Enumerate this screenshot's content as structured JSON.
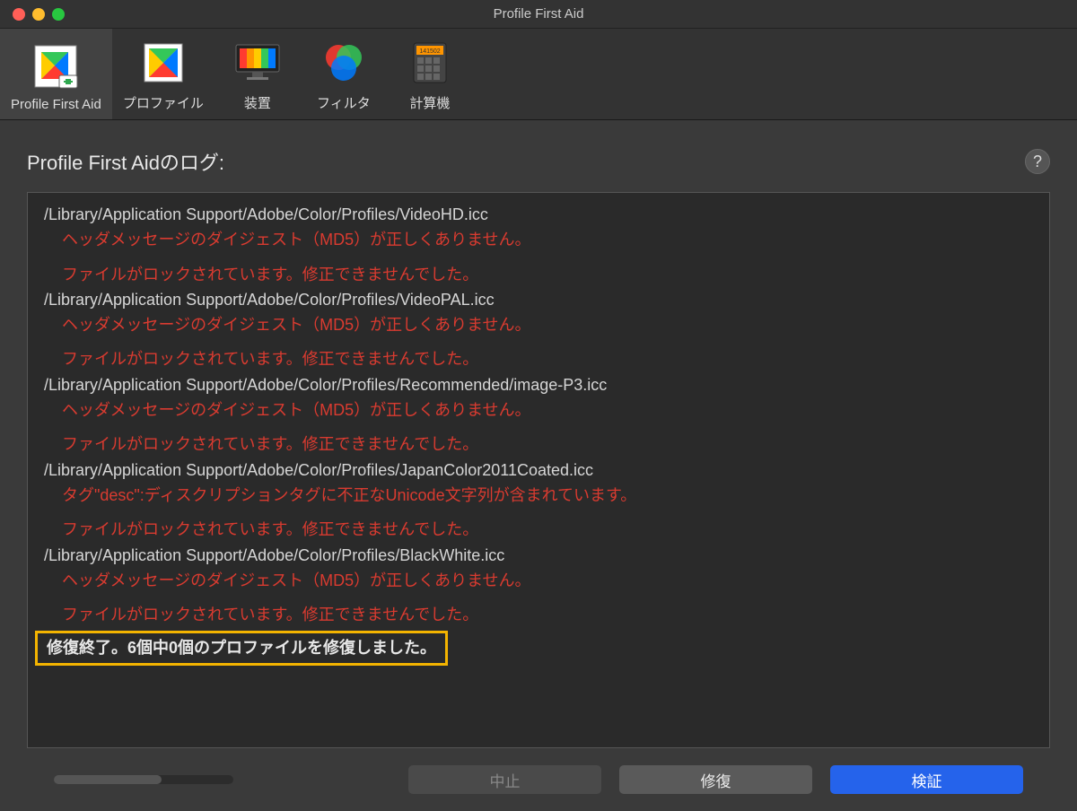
{
  "window": {
    "title": "Profile First Aid"
  },
  "toolbar": {
    "items": [
      {
        "label": "Profile First Aid"
      },
      {
        "label": "プロファイル"
      },
      {
        "label": "装置"
      },
      {
        "label": "フィルタ"
      },
      {
        "label": "計算機"
      }
    ]
  },
  "log": {
    "heading": "Profile First Aidのログ:",
    "entries": [
      {
        "path": "/Library/Application Support/Adobe/Color/Profiles/VideoHD.icc",
        "errors": [
          "ヘッダメッセージのダイジェスト（MD5）が正しくありません。",
          "ファイルがロックされています。修正できませんでした。"
        ]
      },
      {
        "path": "/Library/Application Support/Adobe/Color/Profiles/VideoPAL.icc",
        "errors": [
          "ヘッダメッセージのダイジェスト（MD5）が正しくありません。",
          "ファイルがロックされています。修正できませんでした。"
        ]
      },
      {
        "path": "/Library/Application Support/Adobe/Color/Profiles/Recommended/image-P3.icc",
        "errors": [
          "ヘッダメッセージのダイジェスト（MD5）が正しくありません。",
          "ファイルがロックされています。修正できませんでした。"
        ]
      },
      {
        "path": "/Library/Application Support/Adobe/Color/Profiles/JapanColor2011Coated.icc",
        "errors": [
          "タグ\"desc\":ディスクリプションタグに不正なUnicode文字列が含まれています。",
          "ファイルがロックされています。修正できませんでした。"
        ]
      },
      {
        "path": "/Library/Application Support/Adobe/Color/Profiles/BlackWhite.icc",
        "errors": [
          "ヘッダメッセージのダイジェスト（MD5）が正しくありません。",
          "ファイルがロックされています。修正できませんでした。"
        ]
      }
    ],
    "summary": "修復終了。6個中0個のプロファイルを修復しました。"
  },
  "buttons": {
    "stop": "中止",
    "repair": "修復",
    "verify": "検証"
  },
  "help": "?"
}
